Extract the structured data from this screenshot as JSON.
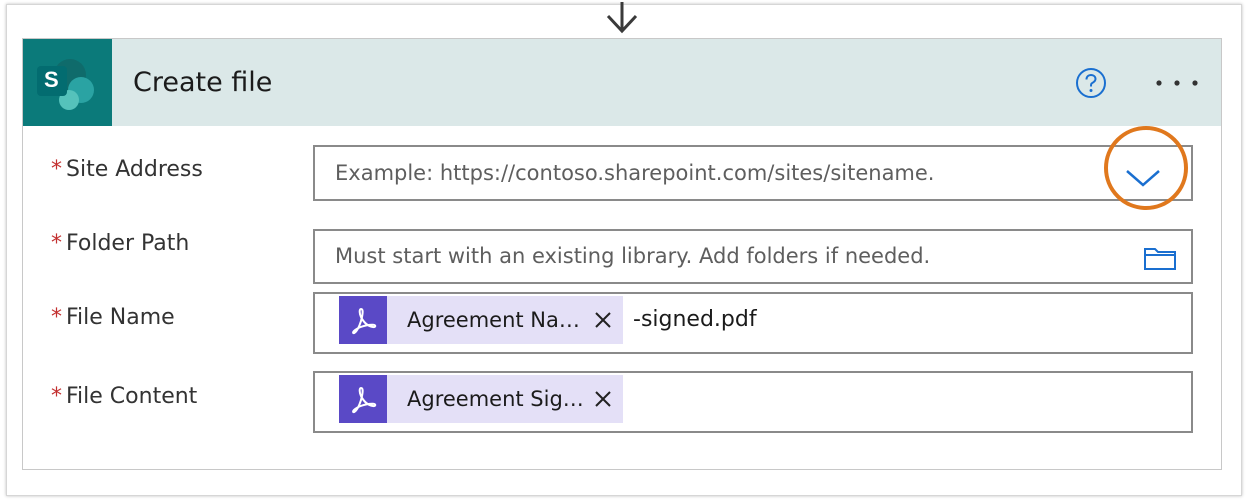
{
  "flow_arrow": {
    "icon": "arrow-down-icon"
  },
  "card": {
    "title": "Create file",
    "logo_letter": "S",
    "header_color": "#dbe8e8",
    "logo_color": "#0b7a7a",
    "help_icon": "question-circle-icon",
    "more_icon": "ellipsis-icon"
  },
  "fields": {
    "site_address": {
      "required": "*",
      "label": "Site Address",
      "placeholder": "Example: https://contoso.sharepoint.com/sites/sitename.",
      "control_icon": "chevron-down-icon"
    },
    "folder_path": {
      "required": "*",
      "label": "Folder Path",
      "placeholder": "Must start with an existing library. Add folders if needed.",
      "control_icon": "folder-icon"
    },
    "file_name": {
      "required": "*",
      "label": "File Name",
      "token_label": "Agreement Na…",
      "token_icon": "adobe-pdf-icon",
      "suffix": "-signed.pdf"
    },
    "file_content": {
      "required": "*",
      "label": "File Content",
      "token_label": "Agreement Sig…",
      "token_icon": "adobe-pdf-icon"
    }
  },
  "annotation": {
    "highlight_color": "#e0781d"
  }
}
